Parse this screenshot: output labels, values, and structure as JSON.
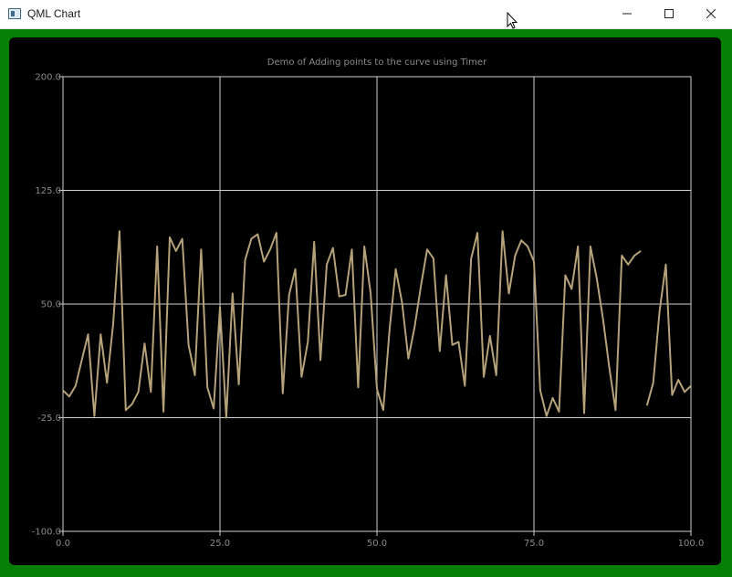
{
  "window": {
    "title": "QML Chart",
    "controls": {
      "minimize": "minimize",
      "maximize": "maximize",
      "close": "close"
    }
  },
  "colors": {
    "frame": "#058005",
    "plot_bg": "#000000",
    "series": "#b5a27a",
    "grid": "#d0d0d0",
    "text": "#8a8a8a"
  },
  "chart_data": {
    "type": "line",
    "title": "Demo of Adding points to the curve using Timer",
    "xlabel": "",
    "ylabel": "",
    "xlim": [
      0,
      100
    ],
    "ylim": [
      -100,
      200
    ],
    "x_ticks": [
      "0.0",
      "25.0",
      "50.0",
      "75.0",
      "100.0"
    ],
    "y_ticks": [
      "200.0",
      "125.0",
      "50.0",
      "-25.0",
      "-100.0"
    ],
    "grid": true,
    "legend": "none",
    "series": [
      {
        "points": [
          [
            0,
            -7
          ],
          [
            1,
            -11
          ],
          [
            2,
            -4
          ],
          [
            3,
            13
          ],
          [
            4,
            30
          ],
          [
            5,
            -24
          ],
          [
            6,
            30
          ],
          [
            7,
            -2
          ],
          [
            8,
            37
          ],
          [
            9,
            98
          ],
          [
            10,
            -20
          ],
          [
            11,
            -16
          ],
          [
            12,
            -8
          ],
          [
            13,
            24
          ],
          [
            14,
            -8
          ],
          [
            15,
            88
          ],
          [
            16,
            -21
          ],
          [
            17,
            94
          ],
          [
            18,
            85
          ],
          [
            19,
            93
          ],
          [
            20,
            23
          ],
          [
            21,
            3
          ],
          [
            22,
            86
          ],
          [
            23,
            -5
          ],
          [
            24,
            -19
          ],
          [
            25,
            48
          ],
          [
            26,
            -25
          ],
          [
            27,
            57
          ],
          [
            28,
            -3
          ],
          [
            29,
            79
          ],
          [
            30,
            93
          ],
          [
            31,
            96
          ],
          [
            32,
            78
          ],
          [
            33,
            86
          ],
          [
            34,
            97
          ],
          [
            35,
            -9
          ],
          [
            36,
            56
          ],
          [
            37,
            73
          ],
          [
            38,
            2
          ],
          [
            39,
            25
          ],
          [
            40,
            91
          ],
          [
            41,
            13
          ],
          [
            42,
            76
          ],
          [
            43,
            87
          ],
          [
            44,
            55
          ],
          [
            45,
            56
          ],
          [
            46,
            86
          ],
          [
            47,
            -5
          ],
          [
            48,
            88
          ],
          [
            49,
            57
          ],
          [
            50,
            -6
          ],
          [
            51,
            -20
          ],
          [
            52,
            33
          ],
          [
            53,
            73
          ],
          [
            54,
            51
          ],
          [
            55,
            14
          ],
          [
            56,
            35
          ],
          [
            57,
            62
          ],
          [
            58,
            86
          ],
          [
            59,
            80
          ],
          [
            60,
            19
          ],
          [
            61,
            69
          ],
          [
            62,
            23
          ],
          [
            63,
            25
          ],
          [
            64,
            -4
          ],
          [
            65,
            80
          ],
          [
            66,
            97
          ],
          [
            67,
            2
          ],
          [
            68,
            29
          ],
          [
            69,
            3
          ],
          [
            70,
            98
          ],
          [
            71,
            57
          ],
          [
            72,
            82
          ],
          [
            73,
            92
          ],
          [
            74,
            88
          ],
          [
            75,
            78
          ],
          [
            76,
            -7
          ],
          [
            77,
            -24
          ],
          [
            78,
            -12
          ],
          [
            79,
            -21
          ],
          [
            80,
            69
          ],
          [
            81,
            60
          ],
          [
            82,
            88
          ],
          [
            83,
            -22
          ],
          [
            84,
            88
          ],
          [
            85,
            67
          ],
          [
            86,
            40
          ],
          [
            87,
            8
          ],
          [
            88,
            -20
          ],
          [
            89,
            82
          ],
          [
            90,
            76
          ],
          [
            91,
            82
          ],
          [
            92,
            85
          ],
          [
            93,
            -17
          ],
          [
            94,
            -2
          ],
          [
            95,
            45
          ],
          [
            96,
            76
          ],
          [
            97,
            -10
          ],
          [
            98,
            0
          ],
          [
            99,
            -8
          ],
          [
            100,
            -4
          ]
        ],
        "gap_after_x": 92
      }
    ]
  }
}
